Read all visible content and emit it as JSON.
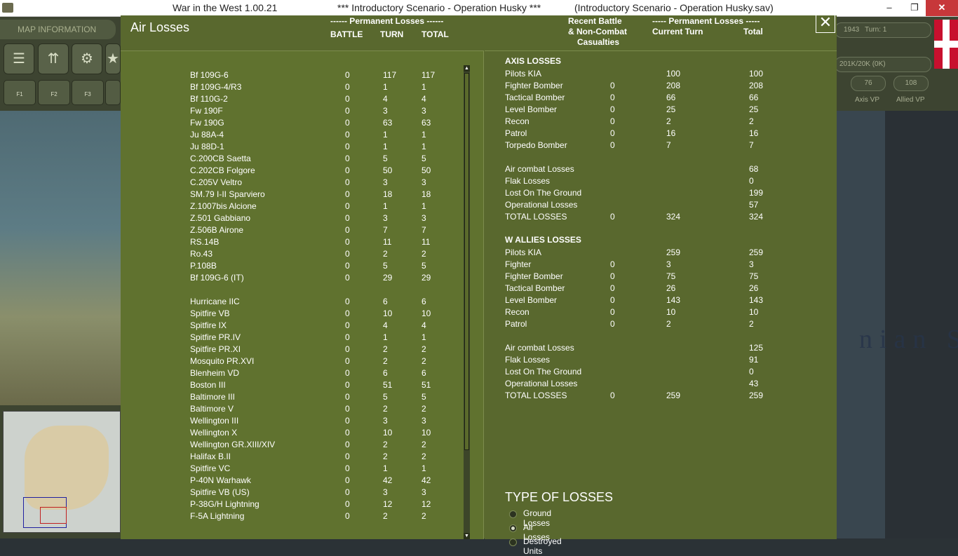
{
  "window": {
    "app_title": "War in the West 1.00.21",
    "scenario_title": "***   Introductory Scenario - Operation Husky   ***",
    "save_title": "(Introductory Scenario - Operation Husky.sav)",
    "min_glyph": "–",
    "max_glyph": "❐",
    "close_glyph": "✕"
  },
  "background": {
    "map_info_label": "MAP INFORMATION",
    "date_text": "1943",
    "turn_text": "Turn: 1",
    "supply_text": "201K/20K (0K)",
    "axis_vp": "76",
    "allied_vp": "108",
    "axis_vp_label": "Axis VP",
    "allied_vp_label": "Allied VP",
    "sea_text": "nian S",
    "toolbar_hotkeys": [
      "F1",
      "F2",
      "F3"
    ]
  },
  "dialog": {
    "title": "Air Losses",
    "close_glyph": "✕",
    "header": {
      "perm_losses": "------ Permanent Losses ------",
      "battle": "BATTLE",
      "turn": "TURN",
      "total": "TOTAL",
      "recent_1": "Recent Battle",
      "recent_2": "& Non-Combat",
      "recent_3": "Casualties",
      "perm_losses_r": "----- Permanent Losses -----",
      "current_turn": "Current Turn",
      "total_r": "Total"
    },
    "aircraft": [
      [
        "Bf 109G-6",
        "0",
        "117",
        "117"
      ],
      [
        "Bf 109G-4/R3",
        "0",
        "1",
        "1"
      ],
      [
        "Bf 110G-2",
        "0",
        "4",
        "4"
      ],
      [
        "Fw 190F",
        "0",
        "3",
        "3"
      ],
      [
        "Fw 190G",
        "0",
        "63",
        "63"
      ],
      [
        "Ju 88A-4",
        "0",
        "1",
        "1"
      ],
      [
        "Ju 88D-1",
        "0",
        "1",
        "1"
      ],
      [
        "C.200CB Saetta",
        "0",
        "5",
        "5"
      ],
      [
        "C.202CB Folgore",
        "0",
        "50",
        "50"
      ],
      [
        "C.205V Veltro",
        "0",
        "3",
        "3"
      ],
      [
        "SM.79 I-II Sparviero",
        "0",
        "18",
        "18"
      ],
      [
        "Z.1007bis Alcione",
        "0",
        "1",
        "1"
      ],
      [
        "Z.501 Gabbiano",
        "0",
        "3",
        "3"
      ],
      [
        "Z.506B Airone",
        "0",
        "7",
        "7"
      ],
      [
        "RS.14B",
        "0",
        "11",
        "11"
      ],
      [
        "Ro.43",
        "0",
        "2",
        "2"
      ],
      [
        "P.108B",
        "0",
        "5",
        "5"
      ],
      [
        "Bf 109G-6 (IT)",
        "0",
        "29",
        "29"
      ],
      null,
      [
        "Hurricane IIC",
        "0",
        "6",
        "6"
      ],
      [
        "Spitfire VB",
        "0",
        "10",
        "10"
      ],
      [
        "Spitfire IX",
        "0",
        "4",
        "4"
      ],
      [
        "Spitfire PR.IV",
        "0",
        "1",
        "1"
      ],
      [
        "Spitfire PR.XI",
        "0",
        "2",
        "2"
      ],
      [
        "Mosquito PR.XVI",
        "0",
        "2",
        "2"
      ],
      [
        "Blenheim VD",
        "0",
        "6",
        "6"
      ],
      [
        "Boston III",
        "0",
        "51",
        "51"
      ],
      [
        "Baltimore III",
        "0",
        "5",
        "5"
      ],
      [
        "Baltimore V",
        "0",
        "2",
        "2"
      ],
      [
        "Wellington III",
        "0",
        "3",
        "3"
      ],
      [
        "Wellington X",
        "0",
        "10",
        "10"
      ],
      [
        "Wellington GR.XIII/XIV",
        "0",
        "2",
        "2"
      ],
      [
        "Halifax B.II",
        "0",
        "2",
        "2"
      ],
      [
        "Spitfire VC",
        "0",
        "1",
        "1"
      ],
      [
        "P-40N Warhawk",
        "0",
        "42",
        "42"
      ],
      [
        "Spitfire VB (US)",
        "0",
        "3",
        "3"
      ],
      [
        "P-38G/H Lightning",
        "0",
        "12",
        "12"
      ],
      [
        "F-5A Lightning",
        "0",
        "2",
        "2"
      ]
    ],
    "axis": {
      "heading": "AXIS LOSSES",
      "rows": [
        [
          "Pilots KIA",
          "",
          "100",
          "100"
        ],
        [
          "Fighter Bomber",
          "0",
          "208",
          "208"
        ],
        [
          "Tactical Bomber",
          "0",
          "66",
          "66"
        ],
        [
          "Level Bomber",
          "0",
          "25",
          "25"
        ],
        [
          "Recon",
          "0",
          "2",
          "2"
        ],
        [
          "Patrol",
          "0",
          "16",
          "16"
        ],
        [
          "Torpedo Bomber",
          "0",
          "7",
          "7"
        ]
      ],
      "summary": [
        [
          "Air combat Losses",
          "",
          "",
          "68"
        ],
        [
          "Flak Losses",
          "",
          "",
          "0"
        ],
        [
          "Lost On The Ground",
          "",
          "",
          "199"
        ],
        [
          "Operational Losses",
          "",
          "",
          "57"
        ],
        [
          "TOTAL LOSSES",
          "0",
          "324",
          "324"
        ]
      ]
    },
    "allies": {
      "heading": "W ALLIES LOSSES",
      "rows": [
        [
          "Pilots KIA",
          "",
          "259",
          "259"
        ],
        [
          "Fighter",
          "0",
          "3",
          "3"
        ],
        [
          "Fighter Bomber",
          "0",
          "75",
          "75"
        ],
        [
          "Tactical Bomber",
          "0",
          "26",
          "26"
        ],
        [
          "Level Bomber",
          "0",
          "143",
          "143"
        ],
        [
          "Recon",
          "0",
          "10",
          "10"
        ],
        [
          "Patrol",
          "0",
          "2",
          "2"
        ]
      ],
      "summary": [
        [
          "Air combat Losses",
          "",
          "",
          "125"
        ],
        [
          "Flak Losses",
          "",
          "",
          "91"
        ],
        [
          "Lost On The Ground",
          "",
          "",
          "0"
        ],
        [
          "Operational Losses",
          "",
          "",
          "43"
        ],
        [
          "TOTAL LOSSES",
          "0",
          "259",
          "259"
        ]
      ]
    },
    "type_of_losses": {
      "title": "TYPE OF LOSSES",
      "options": [
        {
          "label": "Ground Losses",
          "selected": false
        },
        {
          "label": "Air Losses",
          "selected": true
        },
        {
          "label": "Destroyed Units",
          "selected": false
        }
      ]
    },
    "scroll_up_glyph": "▲",
    "scroll_down_glyph": "▼"
  },
  "colors": {
    "dialog_bg": "#59682e",
    "list_bg": "#60722f",
    "text": "#ffffff"
  }
}
